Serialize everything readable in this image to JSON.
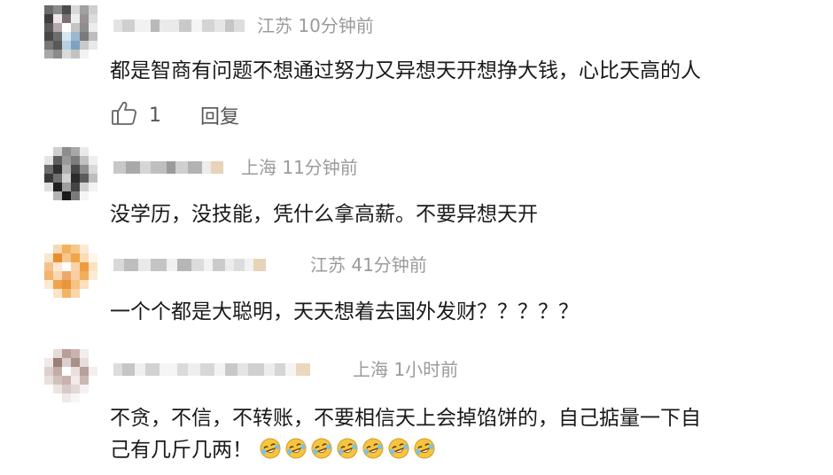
{
  "comments": [
    {
      "location": "江苏",
      "time": "10分钟前",
      "text": "都是智商有问题不想通过努力又异想天开想挣大钱，心比天高的人",
      "likes": "1",
      "reply_label": "回复"
    },
    {
      "location": "上海",
      "time": "11分钟前",
      "text": "没学历，没技能，凭什么拿高薪。不要异想天开"
    },
    {
      "location": "江苏",
      "time": "41分钟前",
      "text": "一个个都是大聪明，天天想着去国外发财？？？？？"
    },
    {
      "location": "上海",
      "time": "1小时前",
      "text_line1": "不贪，不信，不转账，不要相信天上会掉馅饼的，自己掂量一下自",
      "text_line2": "己有几斤几两！",
      "emoji_name": "laugh-cry-emoji",
      "emoji_count": 7
    }
  ],
  "icons": {
    "like": "thumbs-up-icon",
    "avatar": "pixelated-avatar"
  },
  "colors": {
    "text": "#1a1a1a",
    "meta": "#9b9b9b",
    "action": "#555555",
    "emoji_face": "#f5c542"
  }
}
